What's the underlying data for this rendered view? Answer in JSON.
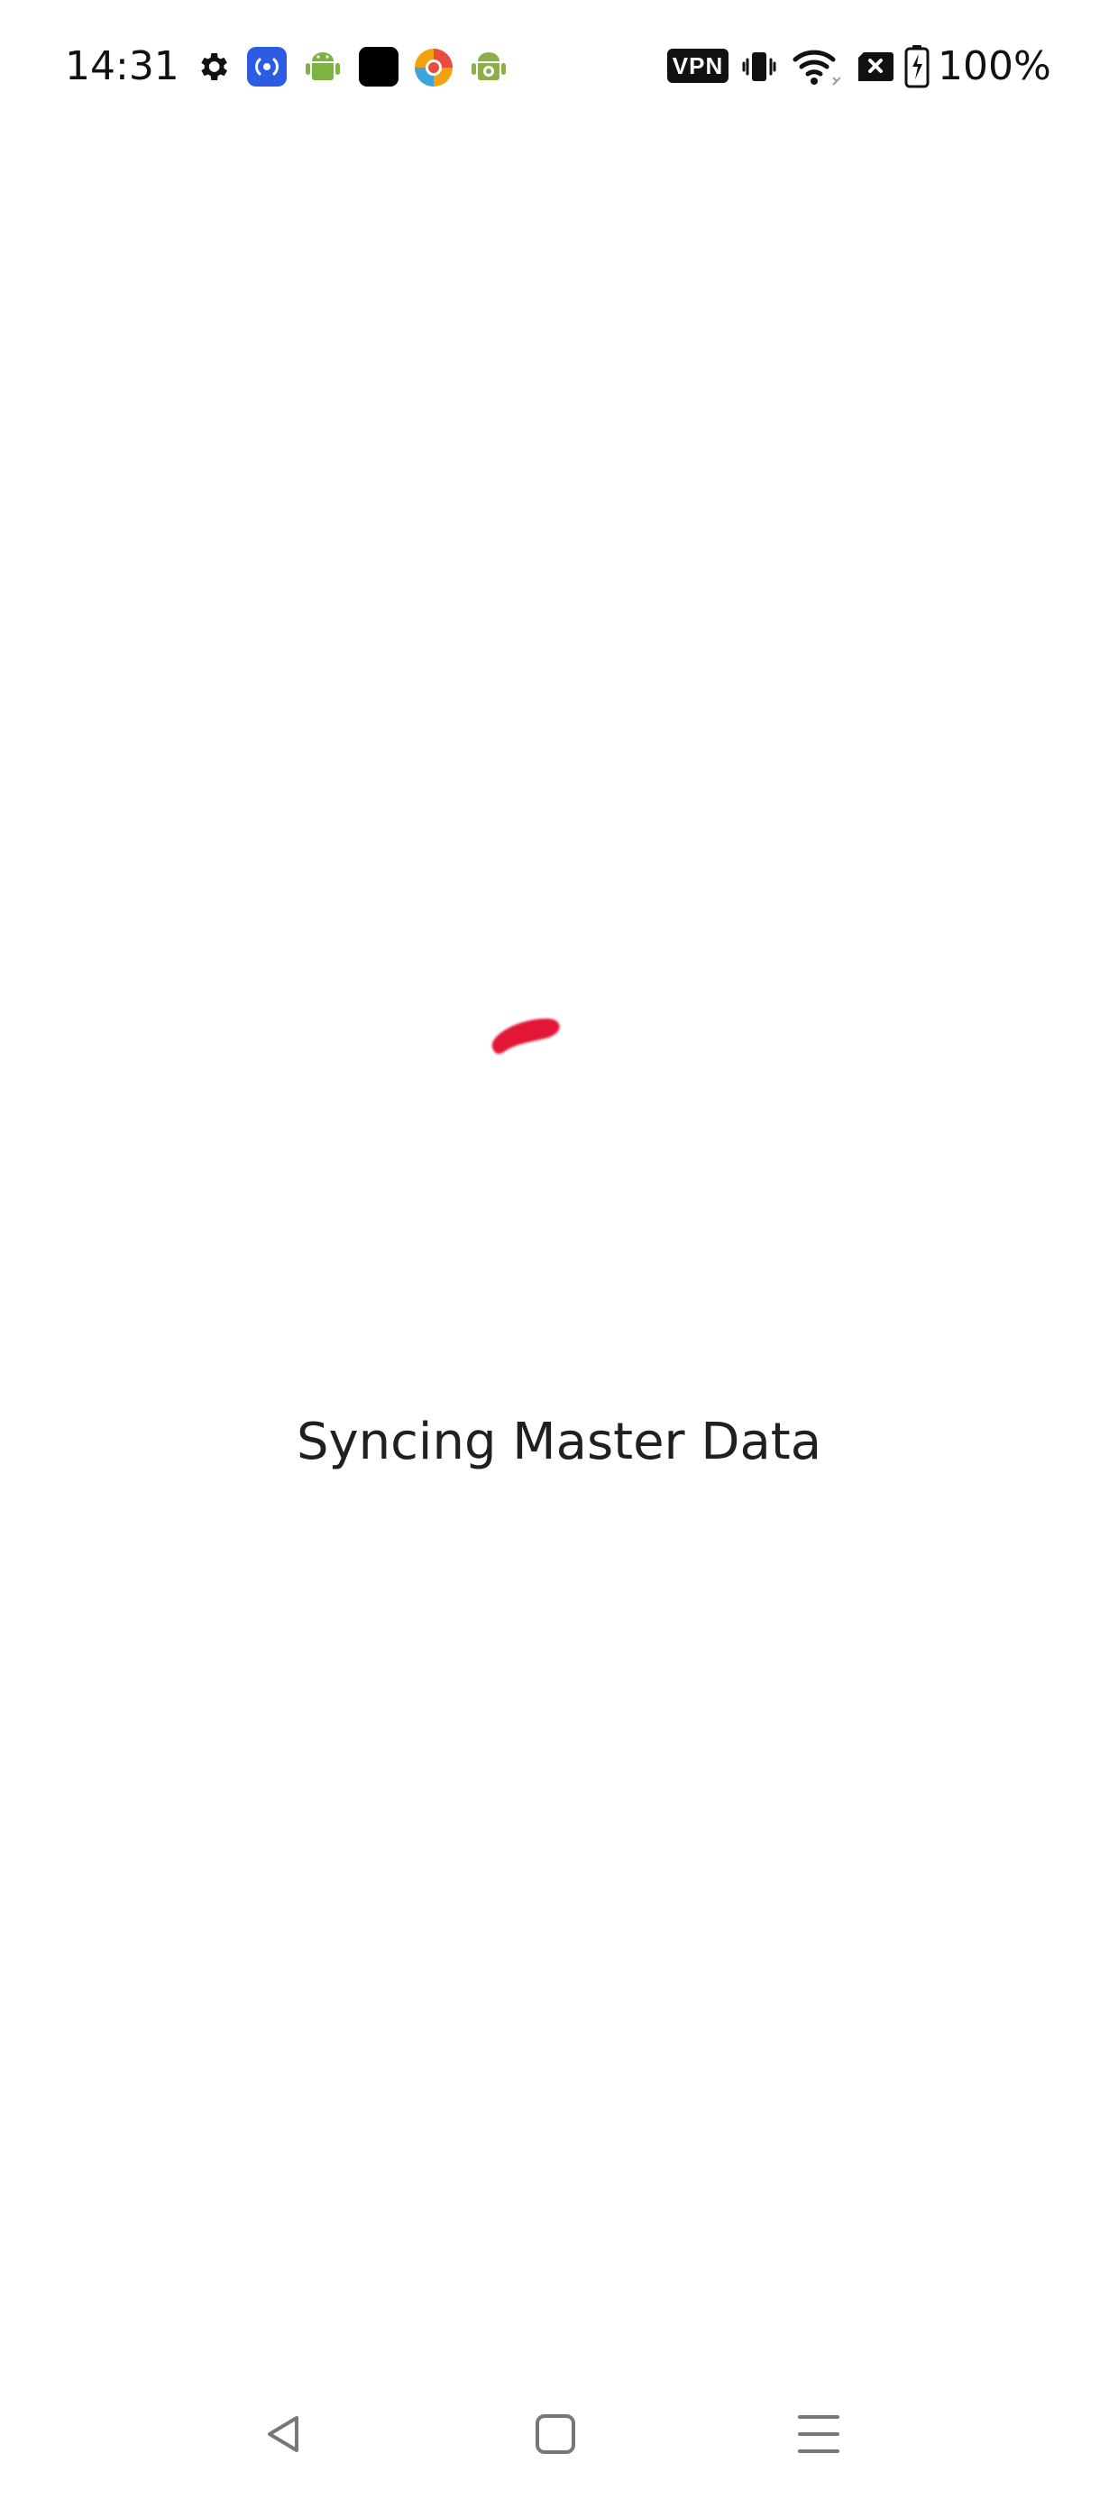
{
  "status_bar": {
    "time": "14:31",
    "vpn_label": "VPN",
    "battery": "100%",
    "left_icons": [
      "settings-icon",
      "broadcast-app-icon",
      "android-icon",
      "black-app-icon",
      "browser-app-icon",
      "android-badge-icon"
    ],
    "right_icons": [
      "vpn-icon",
      "vibrate-icon",
      "wifi-icon",
      "no-sim-icon",
      "battery-charging-icon"
    ]
  },
  "main": {
    "loading_text": "Syncing Master Data",
    "spinner_color": "#e31837"
  },
  "nav_bar": {
    "buttons": [
      "back",
      "home",
      "recents"
    ]
  }
}
